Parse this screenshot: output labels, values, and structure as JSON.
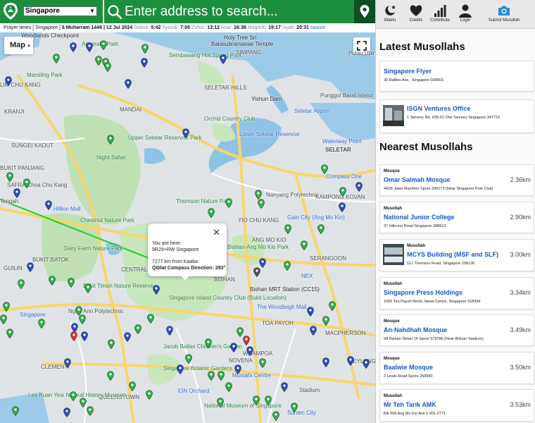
{
  "header": {
    "country": "Singapore",
    "search_placeholder": "Enter address to search...",
    "colors": {
      "primary": "#1c8f3c",
      "locate": "#0f4f25"
    }
  },
  "prayer_bar": {
    "prefix": "Prayer times [ Singapore ]",
    "date": "6 Muharram 1446 | 12 Jul 2024",
    "times": [
      {
        "name": "Subuh:",
        "time": "5:42"
      },
      {
        "name": "Syuruk:",
        "time": "7:05"
      },
      {
        "name": "Zuhur:",
        "time": "13:12"
      },
      {
        "name": "Asar:",
        "time": "16:36"
      },
      {
        "name": "Maghrib:",
        "time": "19:17"
      },
      {
        "name": "Isyak:",
        "time": "20:31"
      }
    ],
    "source_link": "source"
  },
  "map": {
    "type_button": "Map",
    "labels": [
      "Woodlands Checkpoint",
      "Admiralty Park",
      "Marsiling Park",
      "Holy Tree Sri",
      "Balasubramaniar Temple",
      "Sembawang Hot Spring Park",
      "SIMPANG",
      "SELETAR HILLS",
      "Seletar Airport",
      "Punggol Barat Island",
      "Yishun Dam",
      "Orchid Country Club",
      "Lower Seletar Reservoir",
      "Upper Seletar Reservoir Park",
      "Night Safari",
      "SUNGEI KADUT",
      "SELETAR",
      "Waterway Point",
      "SAFRA Choa Chu Kang",
      "Hillion Mall",
      "Chestnut Nature Park",
      "Thomson Nature Park",
      "Nanyang Polytechnic",
      "KAMPONG KOVAN",
      "Compass One",
      "Gain City (Ang Mo Kio)",
      "YIO CHU KANG",
      "Bishan-Ang Mo Kio Park",
      "ANG MO KIO",
      "Dairy Farm Nature Park",
      "BUKIT BATOK",
      "Bukit Timah Nature Reserve",
      "CENTRAL WATER CATCHMENT",
      "Singapore Island Country Club (Bukit Location)",
      "Bishan MRT Station (CC15)",
      "The Woodleigh Mall",
      "TOA PAYOH",
      "BISHAN",
      "Ngee Ann Polytechnic",
      "Jacob Ballas Children's Garden",
      "Singapore Botanic Gardens",
      "ION Orchard",
      "Mustafa Centre",
      "National Museum of Singapore",
      "Suntec City",
      "WHAMPOA",
      "MACPHERSON",
      "CLEMENTI",
      "QUEENSTOWN",
      "Lee Kuan Yew Natural History Museum",
      "GUILIN",
      "KRANJI",
      "SERANGOON",
      "GEYLANG",
      "NOVENA",
      "BUKIT PANJANG",
      "NEX",
      "Singapore",
      "LIM CHU KANG",
      "Stadium",
      "Pulau Ubin",
      "MANDAI",
      "Tengah"
    ],
    "popup": {
      "line1": "You are here:",
      "line2": "9R29+RW Singapore",
      "line3": "7277 km from Kaaba",
      "line4": "Qiblat Compass Direction: 293°"
    }
  },
  "nav": [
    {
      "label": "Waktu",
      "icon": "moon-star-icon"
    },
    {
      "label": "Credits",
      "icon": "heart-icon"
    },
    {
      "label": "Contribute",
      "icon": "signal-bars-icon"
    },
    {
      "label": "Login",
      "icon": "user-icon"
    },
    {
      "label": "Submit Musollah",
      "icon": "camera-icon"
    }
  ],
  "latest": {
    "title": "Latest Musollahs",
    "items": [
      {
        "name": "Singapore Flyer",
        "address": "30 Raffles Ave., Singapore 039803"
      },
      {
        "name": "ISGN Ventures Office",
        "address": "1 Tannery Rd, #05-01 One Tannery Singapore 347719"
      }
    ]
  },
  "nearest": {
    "title": "Nearest Musollahs",
    "items": [
      {
        "type": "Mosque",
        "name": "Omar Salmah Mosque",
        "address": "441B Jalan Mashhor Spore 299173 (Near Singapore Polo Club)",
        "distance": "2.36km"
      },
      {
        "type": "Musollah",
        "name": "National Junior College",
        "address": "37 Hillcrest Road Singapore 288913",
        "distance": "2.90km"
      },
      {
        "type": "Musollah",
        "name": "MCYS Building (MSF and SLF)",
        "address": "512 Thomson Road, Singapore 298136",
        "distance": "3.00km"
      },
      {
        "type": "Musollah",
        "name": "Singapore Press Holdings",
        "address": "1000 Toa Payoh North, News Centre, Singapore 318994",
        "distance": "3.34km"
      },
      {
        "type": "Mosque",
        "name": "An-Nahdhah Mosque",
        "address": "9A Bishan Street 14 Spore 579786 (Near Bishan Stadium)",
        "distance": "3.49km"
      },
      {
        "type": "Mosque",
        "name": "Baalwie Mosque",
        "address": "2 Lewis Road Spore 258590",
        "distance": "3.50km"
      },
      {
        "type": "Musollah",
        "name": "Mr Teh Tarik AMK",
        "address": "Blk 608 Ang Mo Kio Ave 5 #01-2771",
        "distance": "3.53km"
      }
    ]
  }
}
